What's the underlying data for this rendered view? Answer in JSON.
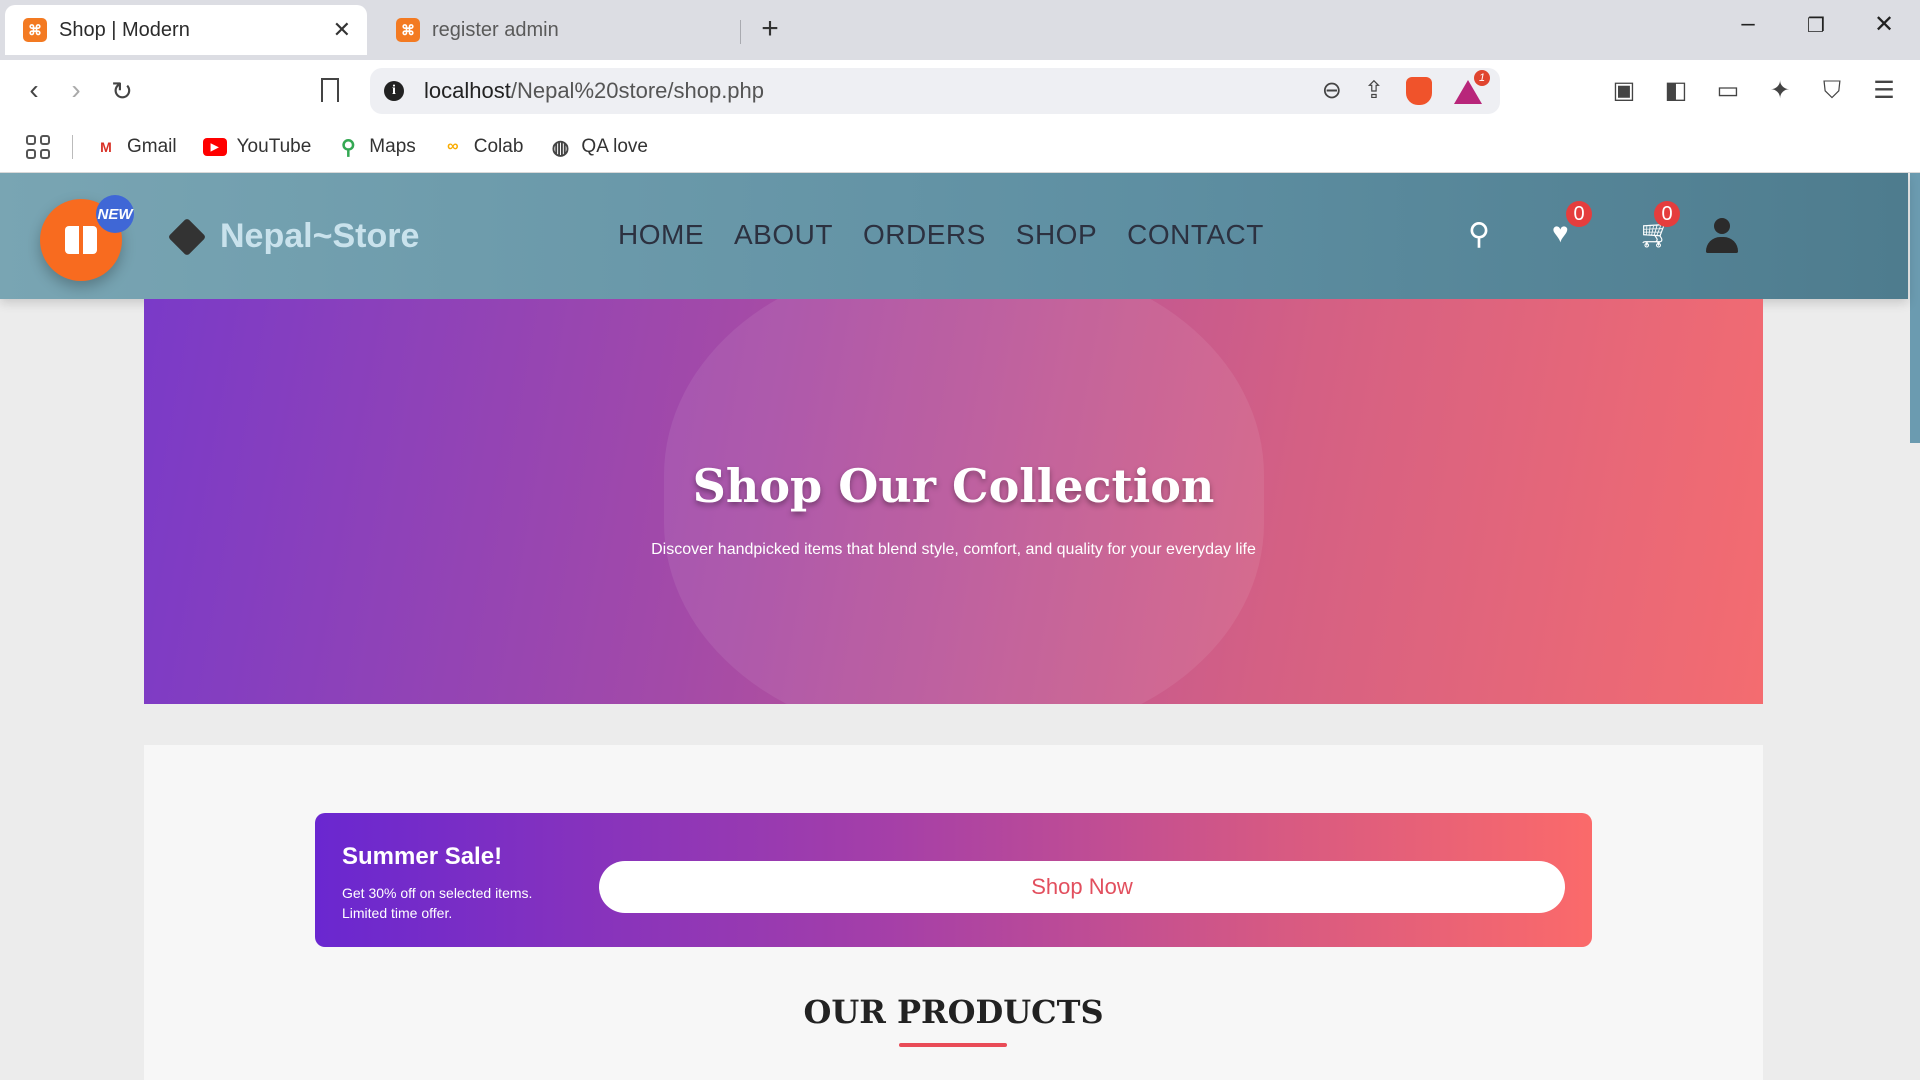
{
  "browser": {
    "tabs": [
      {
        "label": "Shop | Modern",
        "active": true
      },
      {
        "label": "register admin",
        "active": false
      }
    ],
    "url_host": "localhost",
    "url_path": "/Nepal%20store/shop.php",
    "rewards_badge": "1",
    "bookmarks": [
      {
        "label": "Gmail",
        "icon": "gmail-icon"
      },
      {
        "label": "YouTube",
        "icon": "youtube-icon"
      },
      {
        "label": "Maps",
        "icon": "maps-icon"
      },
      {
        "label": "Colab",
        "icon": "colab-icon"
      },
      {
        "label": "QA love",
        "icon": "globe-icon"
      }
    ]
  },
  "site": {
    "new_badge": "NEW",
    "brand": "Nepal~Store",
    "nav": [
      "HOME",
      "ABOUT",
      "ORDERS",
      "SHOP",
      "CONTACT"
    ],
    "wishlist_count": "0",
    "cart_count": "0"
  },
  "hero": {
    "title": "Shop Our Collection",
    "subtitle": "Discover handpicked items that blend style, comfort, and quality for your everyday life"
  },
  "promo": {
    "title": "Summer Sale!",
    "line1": "Get 30% off on selected items.",
    "line2": "Limited time offer.",
    "button": "Shop Now"
  },
  "products": {
    "title": "OUR PRODUCTS"
  },
  "colors": {
    "accent": "#e94b57",
    "header": "#5e8fa2",
    "gift": "#f86b1f"
  }
}
